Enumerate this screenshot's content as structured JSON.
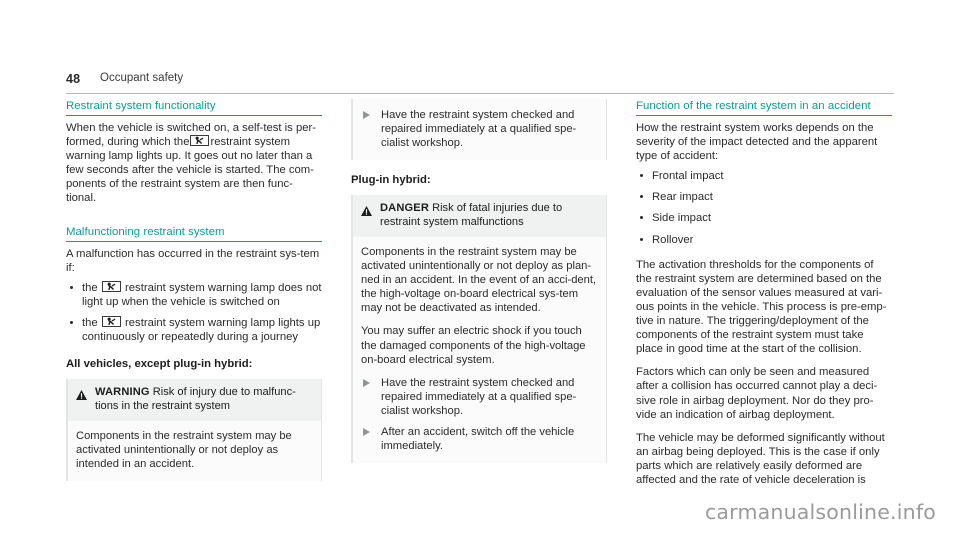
{
  "header": {
    "page_number": "48",
    "chapter": "Occupant safety"
  },
  "icons": {
    "restraint_lamp": "restraint-system-warning-lamp-icon",
    "warning_triangle": "warning-triangle-icon",
    "action_arrow": "action-arrow-icon"
  },
  "colors": {
    "heading_teal": "#0a9c96",
    "hazard_header_bg": "#f0f1f1",
    "body_text": "#2b2b2b",
    "rule": "#b9bcbe"
  },
  "left_column": {
    "heading_1": "Restraint system functionality",
    "para_1_a": "When the vehicle is switched on, a self-test is per-formed, during which the",
    "para_1_b": "restraint system warning lamp lights up. It goes out no later than a few seconds after the vehicle is started. The com-ponents of the restraint system are then func-tional.",
    "heading_2": "Malfunctioning restraint system",
    "para_2": "A malfunction has occurred in the restraint sys-tem if:",
    "bullets": [
      {
        "before": "the",
        "after": "restraint system warning lamp does not light up when the vehicle is switched on"
      },
      {
        "before": "the",
        "after": "restraint system warning lamp lights up continuously or repeatedly during a journey"
      }
    ],
    "lead_in": "All vehicles, except plug-in hybrid:",
    "warning_box": {
      "keyword": "WARNING",
      "title": "Risk of injury due to malfunc-tions in the restraint system",
      "body": "Components in the restraint system may be activated unintentionally or not deploy as intended in an accident."
    }
  },
  "middle_column": {
    "warning_box_continued": {
      "actions": [
        "Have the restraint system checked and repaired immediately at a qualified spe-cialist workshop."
      ]
    },
    "lead_in": "Plug-in hybrid:",
    "danger_box": {
      "keyword": "DANGER",
      "title": "Risk of fatal injuries due to restraint system malfunctions",
      "body_1": "Components in the restraint system may be activated unintentionally or not deploy as plan-ned in an accident. In the event of an acci-dent, the high-voltage on-board electrical sys-tem may not be deactivated as intended.",
      "body_2": "You may suffer an electric shock if you touch the damaged components of the high-voltage on-board electrical system.",
      "actions": [
        "Have the restraint system checked and repaired immediately at a qualified spe-cialist workshop.",
        "After an accident, switch off the vehicle immediately."
      ]
    }
  },
  "right_column": {
    "heading": "Function of the restraint system in an accident",
    "para_1": "How the restraint system works depends on the severity of the impact detected and the apparent type of accident:",
    "bullets": [
      "Frontal impact",
      "Rear impact",
      "Side impact",
      "Rollover"
    ],
    "para_2": "The activation thresholds for the components of the restraint system are determined based on the evaluation of the sensor values measured at vari-ous points in the vehicle. This process is pre-emp-tive in nature. The triggering/deployment of the components of the restraint system must take place in good time at the start of the collision.",
    "para_3": "Factors which can only be seen and measured after a collision has occurred cannot play a deci-sive role in airbag deployment. Nor do they pro-vide an indication of airbag deployment.",
    "para_4": "The vehicle may be deformed significantly without an airbag being deployed. This is the case if only parts which are relatively easily deformed are affected and the rate of vehicle deceleration is"
  },
  "watermark": "carmanualsonline.info"
}
